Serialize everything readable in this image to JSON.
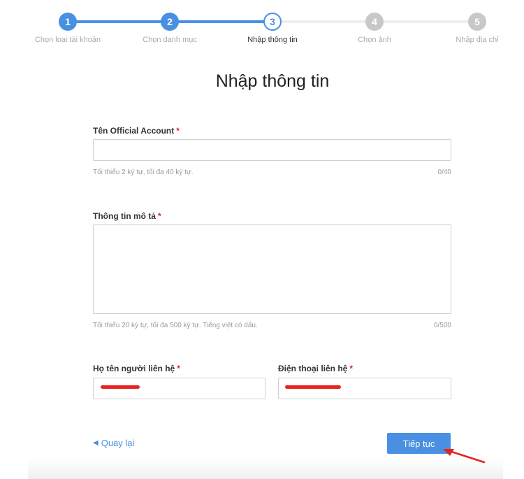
{
  "stepper": {
    "steps": [
      {
        "number": "1",
        "label": "Chọn loại tài khoản",
        "state": "done"
      },
      {
        "number": "2",
        "label": "Chọn danh mục",
        "state": "done"
      },
      {
        "number": "3",
        "label": "Nhập thông tin",
        "state": "active"
      },
      {
        "number": "4",
        "label": "Chọn ảnh",
        "state": "todo"
      },
      {
        "number": "5",
        "label": "Nhập địa chỉ",
        "state": "todo"
      }
    ]
  },
  "page": {
    "title": "Nhập thông tin"
  },
  "form": {
    "required_mark": "*",
    "oa_name": {
      "label": "Tên Official Account",
      "value": "",
      "hint": "Tối thiểu 2 ký tự, tối đa 40 ký tự.",
      "counter": "0/40"
    },
    "description": {
      "label": "Thông tin mô tả",
      "value": "",
      "hint": "Tối thiểu 20 ký tự, tối đa 500 ký tự. Tiếng việt có dấu.",
      "counter": "0/500"
    },
    "contact_name": {
      "label": "Họ tên người liên hệ",
      "value": ""
    },
    "contact_phone": {
      "label": "Điện thoại liên hệ",
      "value": ""
    }
  },
  "actions": {
    "back_label": "Quay lại",
    "next_label": "Tiếp tục"
  },
  "colors": {
    "accent": "#4a90e2",
    "required": "#e0202a",
    "annotation": "#e8231f"
  }
}
